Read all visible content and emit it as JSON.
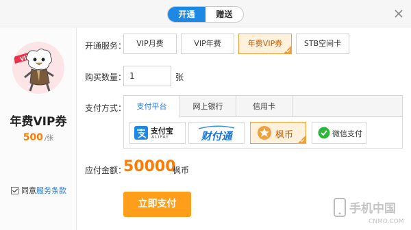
{
  "top_tabs": {
    "open": "开通",
    "gift": "赠送"
  },
  "product": {
    "name": "年费VIP券",
    "price": "500",
    "price_unit": "/张",
    "banner_text": "VIP"
  },
  "agree": {
    "text": "同意",
    "link": "服务条款"
  },
  "labels": {
    "service": "开通服务：",
    "quantity": "购买数量：",
    "pay_method": "支付方式：",
    "amount": "应付金额："
  },
  "services": [
    {
      "label": "VIP月费"
    },
    {
      "label": "VIP年费"
    },
    {
      "label": "年费VIP券"
    },
    {
      "label": "STB空间卡"
    }
  ],
  "quantity": {
    "value": "1",
    "unit": "张"
  },
  "pay_tabs": [
    {
      "label": "支付平台"
    },
    {
      "label": "网上银行"
    },
    {
      "label": "信用卡"
    }
  ],
  "pay_options": {
    "alipay": {
      "name": "支付宝",
      "sub": "ALIPAY"
    },
    "tenpay": {
      "name": "财付通"
    },
    "fengbi": {
      "name": "枫币"
    },
    "wechat": {
      "name": "微信支付"
    }
  },
  "amount": {
    "value": "50000",
    "unit": "枫币"
  },
  "pay_button": "立即支付",
  "watermark": {
    "title": "手机中国",
    "url": "CNMO.COM"
  },
  "colors": {
    "accent": "#1e88e5",
    "orange": "#ff7b00",
    "button": "#ff9e1b",
    "selected_border": "#f2a13a"
  }
}
